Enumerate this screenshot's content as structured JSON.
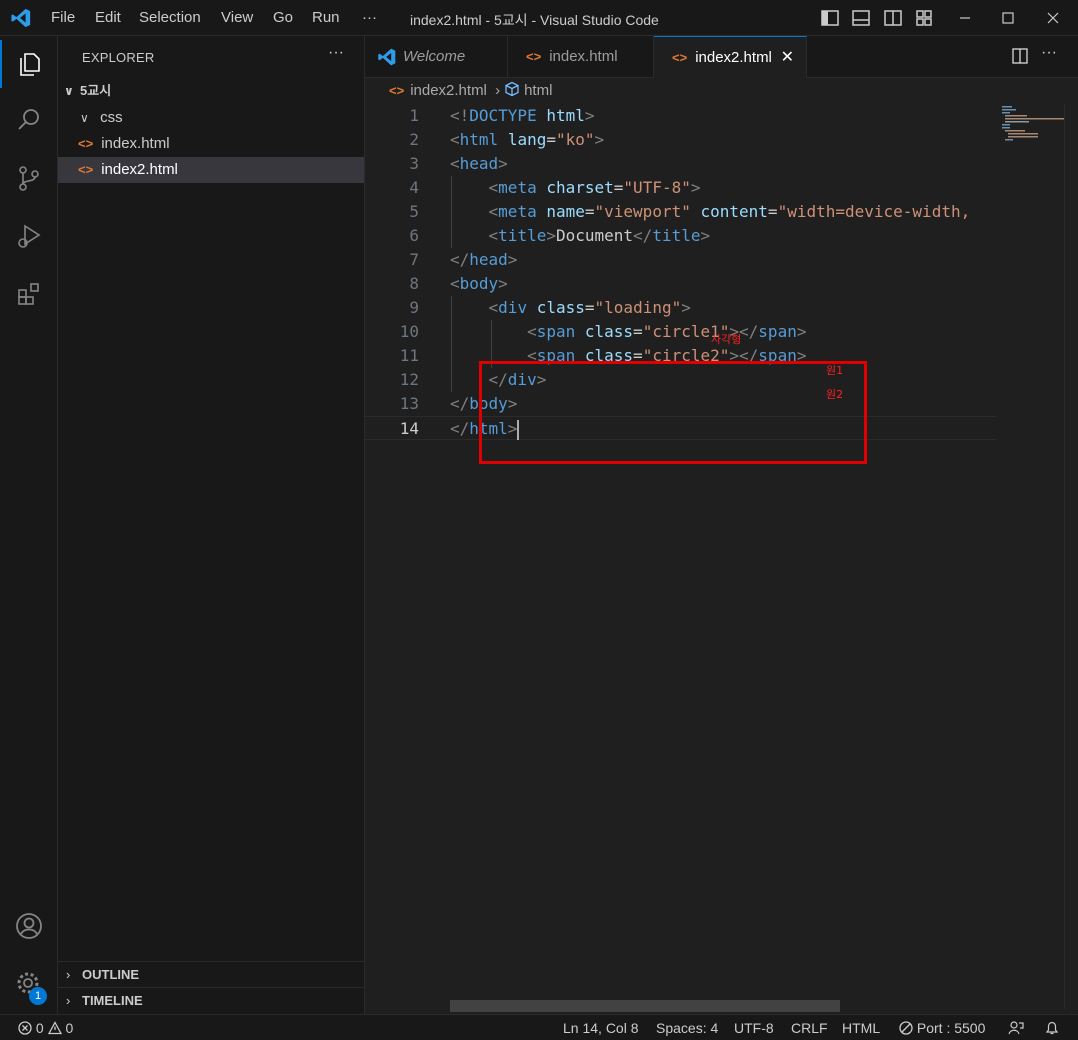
{
  "window": {
    "title": "index2.html - 5교시 - Visual Studio Code"
  },
  "menu": [
    "File",
    "Edit",
    "Selection",
    "View",
    "Go",
    "Run",
    "···"
  ],
  "sidebar": {
    "header": "EXPLORER",
    "more": "···",
    "tree": [
      {
        "label": "5교시",
        "chevron": "∨"
      },
      {
        "label": "css",
        "chevron": "∨"
      },
      {
        "label": "index.html",
        "icon": "<>"
      },
      {
        "label": "index2.html",
        "icon": "<>"
      }
    ],
    "outline": "OUTLINE",
    "timeline": "TIMELINE"
  },
  "tabs": [
    {
      "label": "Welcome"
    },
    {
      "label": "index.html"
    },
    {
      "label": "index2.html",
      "close": "✕"
    }
  ],
  "breadcrumb": {
    "file": "index2.html",
    "separator": "›",
    "symbol": "html"
  },
  "editor": {
    "line_numbers": [
      "1",
      "2",
      "3",
      "4",
      "5",
      "6",
      "7",
      "8",
      "9",
      "10",
      "11",
      "12",
      "13",
      "14"
    ],
    "annotations": {
      "box": "사각형",
      "circle1": "원1",
      "circle2": "원2"
    }
  },
  "activity": {
    "settings_badge": "1"
  },
  "status": {
    "errors": "0",
    "warnings": "0",
    "position": "Ln 14, Col 8",
    "spaces": "Spaces: 4",
    "encoding": "UTF-8",
    "eol": "CRLF",
    "language": "HTML",
    "port": "Port : 5500"
  },
  "colors": {
    "accent": "#0078d4",
    "annotation": "#e00000",
    "tag": "#569cd6",
    "attr": "#9cdcfe",
    "string": "#ce9178"
  }
}
